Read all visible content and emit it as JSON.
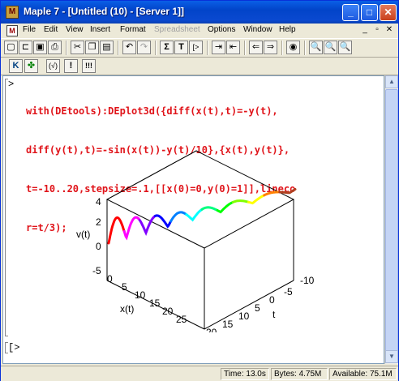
{
  "window": {
    "title": "Maple 7 - [Untitled (10) - [Server 1]]"
  },
  "titlebar_buttons": {
    "minimize": "_",
    "maximize": "□",
    "close": "✕"
  },
  "menu": [
    {
      "label": "File",
      "enabled": true
    },
    {
      "label": "Edit",
      "enabled": true
    },
    {
      "label": "View",
      "enabled": true
    },
    {
      "label": "Insert",
      "enabled": true
    },
    {
      "label": "Format",
      "enabled": true
    },
    {
      "label": "Spreadsheet",
      "enabled": false
    },
    {
      "label": "Options",
      "enabled": true
    },
    {
      "label": "Window",
      "enabled": true
    },
    {
      "label": "Help",
      "enabled": true
    }
  ],
  "mdi_buttons": {
    "minimize": "_",
    "restore": "▫",
    "close": "✕"
  },
  "toolbar": {
    "icons": [
      "new-icon",
      "open-icon",
      "save-icon",
      "print-icon",
      "cut-icon",
      "copy-icon",
      "paste-icon",
      "undo-icon",
      "redo-icon",
      "sigma-icon",
      "text-icon",
      "prompt-icon",
      "indent-icon",
      "outdent-icon",
      "back-icon",
      "forward-icon",
      "stop-icon",
      "zoom-out-icon",
      "zoom-in-icon",
      "zoom-fit-icon"
    ],
    "glyphs": {
      "sigma": "Σ",
      "text": "T",
      "prompt": "[>"
    }
  },
  "context_bar": {
    "math_mode": "K",
    "maple_mode": "✤",
    "check": "(√)",
    "execute": "!",
    "execute_all": "!!!"
  },
  "worksheet": {
    "prompt": ">",
    "command_lines": [
      "with(DEtools):DEplot3d({diff(x(t),t)=-y(t),",
      "diff(y(t),t)=-sin(x(t))-y(t)/10},{x(t),y(t)},",
      "t=-10..20,stepsize=.1,[[x(0)=0,y(0)=1]],lineco",
      "r=t/3);"
    ],
    "next_prompt": "[>"
  },
  "plot": {
    "axes": {
      "x_label": "x(t)",
      "y_label": "v(t)",
      "t_label": "t"
    },
    "x_ticks": [
      "-5",
      "0",
      "5",
      "10",
      "15",
      "20",
      "25"
    ],
    "y_ticks": [
      "4",
      "2",
      "0"
    ],
    "t_ticks": [
      "-10",
      "-5",
      "0",
      "5",
      "10",
      "15",
      "20"
    ],
    "curve_colors": [
      "#ff0000",
      "#ff00ff",
      "#8000ff",
      "#0000ff",
      "#0080ff",
      "#00ffff",
      "#00ff80",
      "#00ff00",
      "#80ff00",
      "#ffff00",
      "#ff8000",
      "#b04020"
    ]
  },
  "status": {
    "time": "Time: 13.0s",
    "bytes": "Bytes: 4.75M",
    "available": "Available: 75.1M"
  }
}
